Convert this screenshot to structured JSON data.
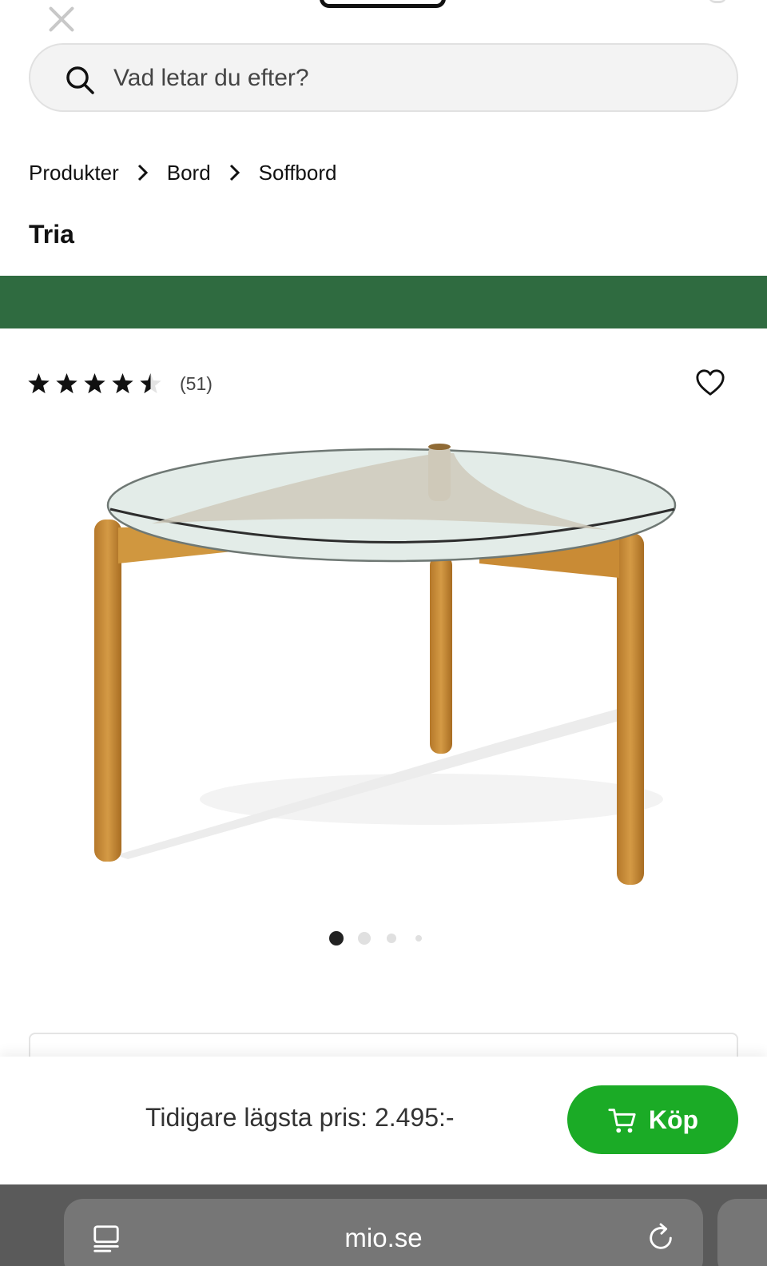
{
  "search": {
    "placeholder": "Vad letar du efter?"
  },
  "breadcrumb": [
    "Produkter",
    "Bord",
    "Soffbord"
  ],
  "product": {
    "title": "Tria",
    "rating": 4.5,
    "rating_max": 5,
    "review_count": "(51)",
    "image_count": 4,
    "active_image": 1
  },
  "buy": {
    "previous_price_label": "Tidigare lägsta pris: 2.495:-",
    "button_label": "Köp"
  },
  "browser": {
    "url": "mio.se"
  },
  "colors": {
    "brand_green": "#2f6b40",
    "buy_green": "#1bab26",
    "browser_bar": "#5a5a5a"
  },
  "icons": [
    "close-icon",
    "search-icon",
    "chevron-right-icon",
    "star-icon",
    "heart-icon",
    "cart-icon",
    "tabs-icon",
    "reload-icon"
  ]
}
